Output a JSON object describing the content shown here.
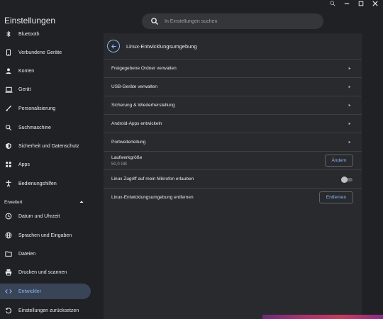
{
  "app": {
    "title": "Einstellungen"
  },
  "search": {
    "placeholder": "In Einstellungen suchen"
  },
  "sidebar": {
    "items": [
      {
        "label": "Bluetooth",
        "icon": "bluetooth-icon"
      },
      {
        "label": "Verbundene Geräte",
        "icon": "phone-icon"
      },
      {
        "label": "Konten",
        "icon": "person-icon"
      },
      {
        "label": "Gerät",
        "icon": "laptop-icon"
      },
      {
        "label": "Personalisierung",
        "icon": "brush-icon"
      },
      {
        "label": "Suchmaschine",
        "icon": "search-icon"
      },
      {
        "label": "Sicherheit und Datenschutz",
        "icon": "shield-icon"
      },
      {
        "label": "Apps",
        "icon": "apps-grid-icon"
      },
      {
        "label": "Bedienungshilfen",
        "icon": "accessibility-icon"
      }
    ],
    "section_advanced": "Erweitert",
    "advanced_items": [
      {
        "label": "Datum und Uhrzeit",
        "icon": "clock-icon"
      },
      {
        "label": "Sprachen und Eingaben",
        "icon": "globe-icon"
      },
      {
        "label": "Dateien",
        "icon": "folder-icon"
      },
      {
        "label": "Drucken und scannen",
        "icon": "printer-icon"
      },
      {
        "label": "Entwickler",
        "icon": "code-icon",
        "active": true
      },
      {
        "label": "Einstellungen zurücksetzen",
        "icon": "reset-icon"
      }
    ]
  },
  "main": {
    "title": "Linux-Entwicklungsumgebung",
    "rows": [
      {
        "label": "Freigegebene Ordner verwalten"
      },
      {
        "label": "USB-Geräte verwalten"
      },
      {
        "label": "Sicherung & Wiederherstellung"
      },
      {
        "label": "Android-Apps entwickeln"
      },
      {
        "label": "Portweiterleitung"
      }
    ],
    "disk": {
      "label": "Laufwerkgröße",
      "value": "50,0 GB",
      "button": "Ändern"
    },
    "mic": {
      "label": "Linux Zugriff auf mein Mikrofon erlauben",
      "enabled": false
    },
    "remove": {
      "label": "Linux-Entwicklungsumgebung entfernen",
      "button": "Entfernen"
    }
  },
  "colors": {
    "accent": "#8ab4f8",
    "background": "#202124",
    "card": "#292a2d",
    "active_item": "#394457"
  }
}
